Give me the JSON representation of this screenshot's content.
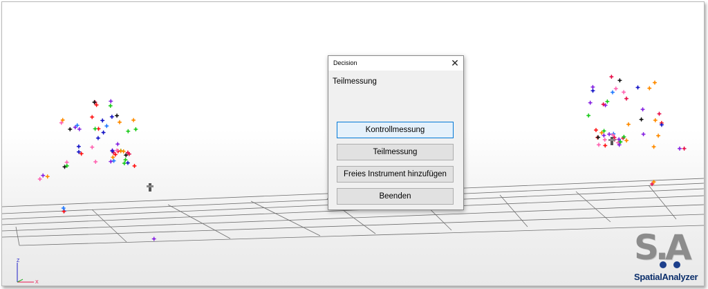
{
  "dialog": {
    "title": "Decision",
    "close_glyph": "✕",
    "message": "Teilmessung",
    "buttons": [
      {
        "label": "Kontrollmessung",
        "default": true
      },
      {
        "label": "Teilmessung",
        "default": false
      },
      {
        "label": "Freies Instrument hinzufügen",
        "default": false
      },
      {
        "label": "Beenden",
        "default": false
      }
    ]
  },
  "logo": {
    "mark": "S.A",
    "name": "SpatialAnalyzer",
    "colors": {
      "mark": "#8c8c8c",
      "dots": "#1c3f8c",
      "text": "#0c2f6b"
    }
  },
  "scene": {
    "axis_labels": {
      "x": "X",
      "z": "Z"
    },
    "point_colors": [
      "#e8174f",
      "#1c1cc8",
      "#22cc22",
      "#ff8c00",
      "#8a2be2",
      "#ff69b4",
      "#2a7fff",
      "#ff1a1a",
      "#1a1a1a"
    ]
  }
}
